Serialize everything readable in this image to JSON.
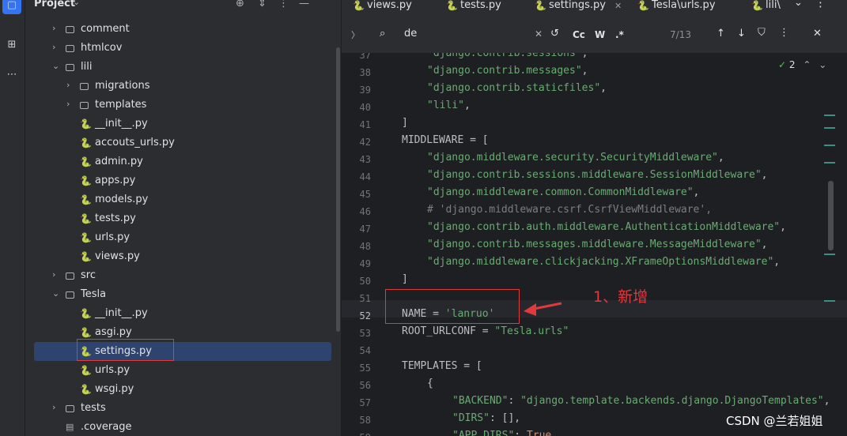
{
  "toolstrip": {
    "icons": [
      "folder-icon",
      "structure-icon",
      "more-icon"
    ]
  },
  "project_panel": {
    "title": "Project",
    "tree": [
      {
        "label": "comment",
        "kind": "folder"
      },
      {
        "label": "htmlcov",
        "kind": "folder"
      },
      {
        "label": "lili",
        "kind": "folder",
        "expanded": true
      },
      {
        "label": "migrations",
        "kind": "folder"
      },
      {
        "label": "templates",
        "kind": "folder"
      },
      {
        "label": "__init__.py",
        "kind": "python"
      },
      {
        "label": "accouts_urls.py",
        "kind": "python"
      },
      {
        "label": "admin.py",
        "kind": "python"
      },
      {
        "label": "apps.py",
        "kind": "python"
      },
      {
        "label": "models.py",
        "kind": "python"
      },
      {
        "label": "tests.py",
        "kind": "python"
      },
      {
        "label": "urls.py",
        "kind": "python"
      },
      {
        "label": "views.py",
        "kind": "python"
      },
      {
        "label": "src",
        "kind": "folder"
      },
      {
        "label": "Tesla",
        "kind": "folder",
        "expanded": true
      },
      {
        "label": "__init__.py",
        "kind": "python"
      },
      {
        "label": "asgi.py",
        "kind": "python"
      },
      {
        "label": "settings.py",
        "kind": "python",
        "selected": true
      },
      {
        "label": "urls.py",
        "kind": "python"
      },
      {
        "label": "wsgi.py",
        "kind": "python"
      },
      {
        "label": "tests",
        "kind": "folder"
      },
      {
        "label": ".coverage",
        "kind": "file"
      }
    ]
  },
  "tabs": [
    {
      "label": "views.py"
    },
    {
      "label": "tests.py"
    },
    {
      "label": "settings.py",
      "active": true
    },
    {
      "label": "Tesla\\urls.py"
    },
    {
      "label": "lili\\"
    }
  ],
  "find": {
    "query": "de",
    "match_case": "Cc",
    "words": "W",
    "regex": ".*",
    "counter": "7/13"
  },
  "editor": {
    "inspections_count": "2",
    "lines": [
      {
        "n": "37",
        "text": "\"django.contrib.sessions\","
      },
      {
        "n": "38",
        "text": "\"django.contrib.messages\","
      },
      {
        "n": "39",
        "text": "\"django.contrib.staticfiles\","
      },
      {
        "n": "40",
        "text": "\"lili\","
      },
      {
        "n": "41",
        "text": "]"
      },
      {
        "n": "42",
        "text": "MIDDLEWARE = ["
      },
      {
        "n": "43",
        "text": "\"django.middleware.security.SecurityMiddleware\","
      },
      {
        "n": "44",
        "text": "\"django.contrib.sessions.middleware.SessionMiddleware\","
      },
      {
        "n": "45",
        "text": "\"django.middleware.common.CommonMiddleware\","
      },
      {
        "n": "46",
        "text": "# 'django.middleware.csrf.CsrfViewMiddleware',"
      },
      {
        "n": "47",
        "text": "\"django.contrib.auth.middleware.AuthenticationMiddleware\","
      },
      {
        "n": "48",
        "text": "\"django.contrib.messages.middleware.MessageMiddleware\","
      },
      {
        "n": "49",
        "text": "\"django.middleware.clickjacking.XFrameOptionsMiddleware\","
      },
      {
        "n": "50",
        "text": "]"
      },
      {
        "n": "51",
        "text": ""
      },
      {
        "n": "52",
        "text": "NAME = 'lanruo'"
      },
      {
        "n": "53",
        "text": "ROOT_URLCONF = \"Tesla.urls\""
      },
      {
        "n": "54",
        "text": ""
      },
      {
        "n": "55",
        "text": "TEMPLATES = ["
      },
      {
        "n": "56",
        "text": "{"
      },
      {
        "n": "57",
        "text": "\"BACKEND\": \"django.template.backends.django.DjangoTemplates\","
      },
      {
        "n": "58",
        "text": "\"DIRS\": [],"
      },
      {
        "n": "59",
        "text": "\"APP_DIRS\": True,"
      }
    ]
  },
  "annotation": {
    "text": "1、新增"
  },
  "watermark": "CSDN @兰若姐姐"
}
